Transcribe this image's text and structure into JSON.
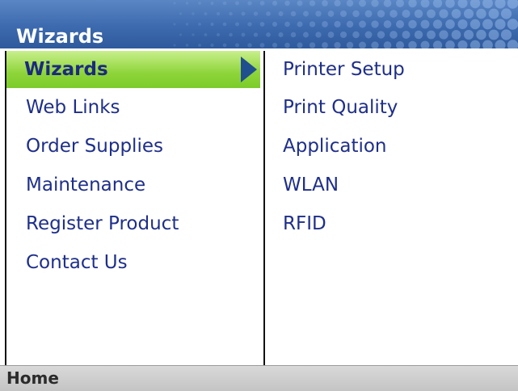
{
  "titlebar": {
    "title": "Wizards"
  },
  "menu": {
    "selected_index": 0,
    "items": [
      {
        "label": "Wizards"
      },
      {
        "label": "Web Links"
      },
      {
        "label": "Order Supplies"
      },
      {
        "label": "Maintenance"
      },
      {
        "label": "Register Product"
      },
      {
        "label": "Contact Us"
      }
    ]
  },
  "submenu": {
    "items": [
      {
        "label": "Printer Setup"
      },
      {
        "label": "Print Quality"
      },
      {
        "label": "Application"
      },
      {
        "label": "WLAN"
      },
      {
        "label": "RFID"
      }
    ]
  },
  "bottombar": {
    "home_label": "Home"
  },
  "colors": {
    "title_bar": "#3d6aae",
    "menu_text": "#1e2f8a",
    "selected_highlight": "#8ed43a",
    "arrow": "#1f4f8f",
    "bottom_bar": "#cccccc"
  },
  "icons": {
    "selected_indicator": "triangle-right-icon"
  }
}
